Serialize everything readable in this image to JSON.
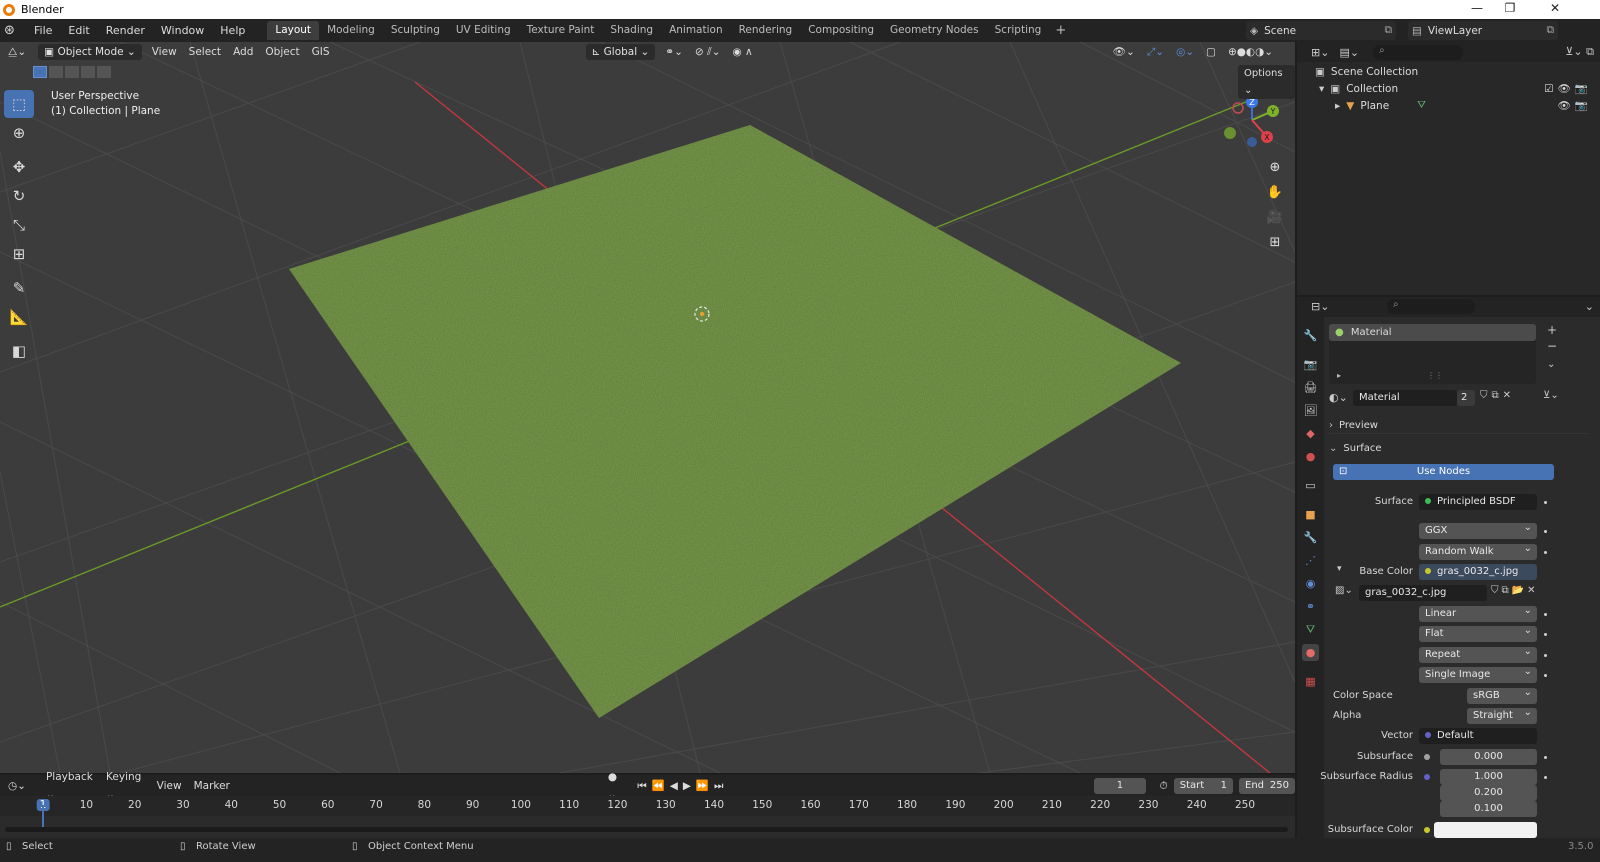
{
  "window": {
    "title": "Blender",
    "controls": [
      "—",
      "❐",
      "✕"
    ]
  },
  "menu": [
    "File",
    "Edit",
    "Render",
    "Window",
    "Help"
  ],
  "workspaces": [
    "Layout",
    "Modeling",
    "Sculpting",
    "UV Editing",
    "Texture Paint",
    "Shading",
    "Animation",
    "Rendering",
    "Compositing",
    "Geometry Nodes",
    "Scripting"
  ],
  "active_workspace": "Layout",
  "scene": {
    "name": "Scene",
    "view_layer": "ViewLayer"
  },
  "viewport": {
    "mode": "Object Mode",
    "menus": [
      "View",
      "Select",
      "Add",
      "Object",
      "GIS"
    ],
    "transform_orientation": "Global",
    "options_label": "Options",
    "view_name": "User Perspective",
    "collection_info": "(1) Collection | Plane",
    "tools": [
      "select-box",
      "cursor",
      "move",
      "rotate",
      "scale",
      "transform",
      "annotate",
      "measure",
      "add-cube"
    ],
    "gizmo": {
      "z": "Z",
      "y": "Y",
      "x": "X"
    },
    "colors": {
      "grid_bg": "#3c3c3c",
      "x_axis": "#c1373f",
      "y_axis": "#6a9b26",
      "plane": "#5f7a32",
      "accent": "#4772b3"
    }
  },
  "outliner": {
    "rows": [
      {
        "label": "Scene Collection",
        "icon": "scene-collection-icon"
      },
      {
        "label": "Collection",
        "icon": "collection-icon"
      },
      {
        "label": "Plane",
        "icon": "mesh-icon"
      }
    ]
  },
  "properties": {
    "material_slot": "Material",
    "material_name": "Material",
    "user_count": "2",
    "panels": {
      "preview": "Preview",
      "surface": "Surface"
    },
    "use_nodes": "Use Nodes",
    "surface_label": "Surface",
    "surface_shader": "Principled BSDF",
    "distribution": "GGX",
    "subsurface_method": "Random Walk",
    "base_color_label": "Base Color",
    "base_color_value": "gras_0032_c.jpg",
    "image_name": "gras_0032_c.jpg",
    "interpolation": "Linear",
    "projection": "Flat",
    "extension": "Repeat",
    "source": "Single Image",
    "color_space_label": "Color Space",
    "color_space": "sRGB",
    "alpha_label": "Alpha",
    "alpha": "Straight",
    "vector_label": "Vector",
    "vector": "Default",
    "subsurface_label": "Subsurface",
    "subsurface": "0.000",
    "subsurface_radius_label": "Subsurface Radius",
    "subsurface_radius": [
      "1.000",
      "0.200",
      "0.100"
    ],
    "subsurface_color_label": "Subsurface Color"
  },
  "timeline": {
    "menus": [
      "Playback",
      "Keying",
      "View",
      "Marker"
    ],
    "current_frame": "1",
    "start_label": "Start",
    "start": "1",
    "end_label": "End",
    "end": "250",
    "ticks": [
      "1",
      "10",
      "20",
      "30",
      "40",
      "50",
      "60",
      "70",
      "80",
      "90",
      "100",
      "110",
      "120",
      "130",
      "140",
      "150",
      "160",
      "170",
      "180",
      "190",
      "200",
      "210",
      "220",
      "230",
      "240",
      "250"
    ]
  },
  "status": {
    "select": "Select",
    "rotate": "Rotate View",
    "context": "Object Context Menu",
    "version": "3.5.0"
  }
}
